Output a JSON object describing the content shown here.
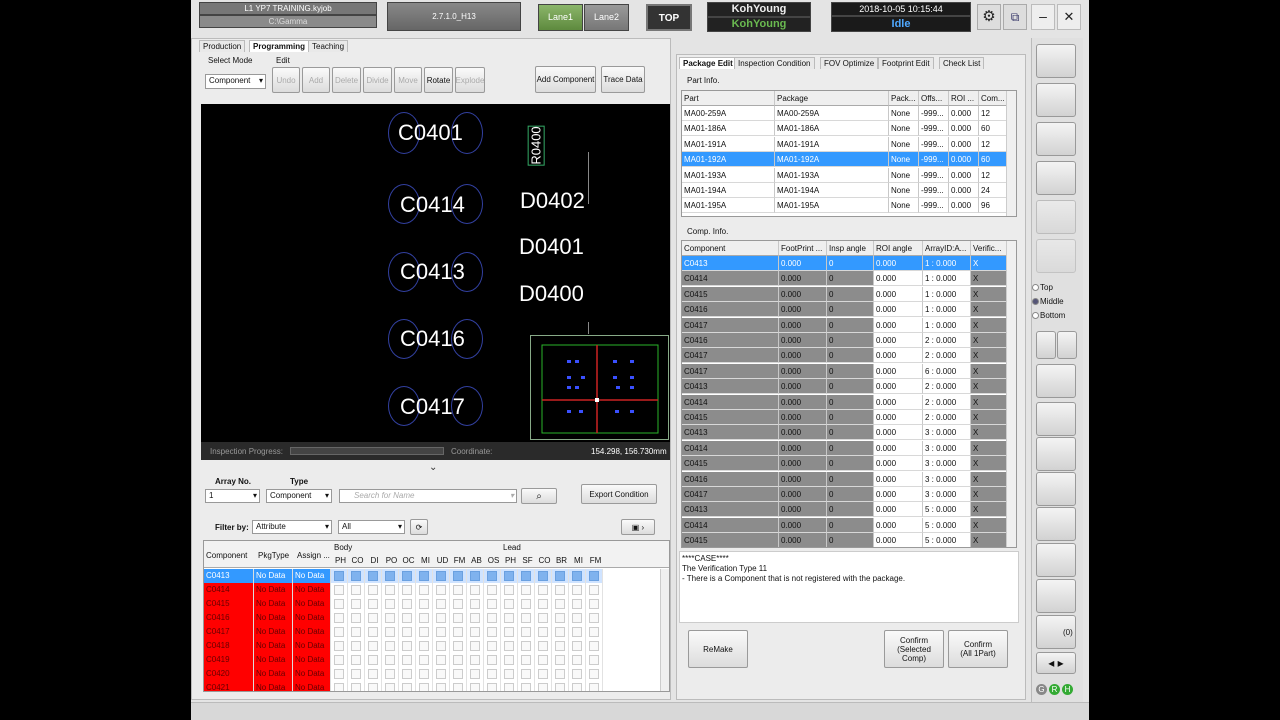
{
  "window": {
    "job_name": "L1 YP7 TRAINING.kyjob",
    "job_path": "C:\\Gamma",
    "version": "2.7.1.0_H13",
    "lane1": "Lane1",
    "lane2": "Lane2",
    "top_button": "TOP",
    "brand1": "KohYoung",
    "brand2": "KohYoung",
    "datetime": "2018-10-05 10:15:44",
    "status": "Idle"
  },
  "left_tabs": [
    "Production",
    "Programming",
    "Teaching"
  ],
  "select_mode": {
    "label": "Select Mode",
    "value": "Component"
  },
  "edit": {
    "label": "Edit",
    "buttons": [
      "Undo",
      "Add",
      "Delete",
      "Divide",
      "Move",
      "Rotate",
      "Explode"
    ]
  },
  "actions": {
    "add_component": "Add Component",
    "trace_data": "Trace Data"
  },
  "canvas": {
    "labels": [
      "C0401",
      "C0414",
      "C0413",
      "C0416",
      "C0417",
      "D0402",
      "D0401",
      "D0400",
      "R0400"
    ],
    "progress_label": "Inspection Progress:",
    "coord_label": "Coordinate:",
    "coord_value": "154.298, 156.730mm"
  },
  "lower": {
    "array_no_label": "Array No.",
    "array_no_value": "1",
    "type_label": "Type",
    "type_value": "Component",
    "search_placeholder": "Search for Name",
    "export_condition": "Export Condition",
    "filter_label": "Filter by:",
    "filter_value": "Attribute",
    "filter_value2": "All",
    "headers": {
      "component": "Component",
      "pkgtype": "PkgType",
      "assign": "Assign ...",
      "body": "Body",
      "lead": "Lead"
    },
    "body_cols": [
      "PH",
      "CO",
      "DI",
      "PO",
      "OC",
      "MI",
      "UD",
      "FM",
      "AB",
      "OS"
    ],
    "lead_cols": [
      "PH",
      "SF",
      "CO",
      "BR",
      "MI",
      "FM"
    ],
    "rows": [
      {
        "c": "C0413",
        "p": "No Data",
        "a": "No Data"
      },
      {
        "c": "C0414",
        "p": "No Data",
        "a": "No Data"
      },
      {
        "c": "C0415",
        "p": "No Data",
        "a": "No Data"
      },
      {
        "c": "C0416",
        "p": "No Data",
        "a": "No Data"
      },
      {
        "c": "C0417",
        "p": "No Data",
        "a": "No Data"
      },
      {
        "c": "C0418",
        "p": "No Data",
        "a": "No Data"
      },
      {
        "c": "C0419",
        "p": "No Data",
        "a": "No Data"
      },
      {
        "c": "C0420",
        "p": "No Data",
        "a": "No Data"
      },
      {
        "c": "C0421",
        "p": "No Data",
        "a": "No Data"
      }
    ]
  },
  "right_tabs": [
    "Package Edit",
    "Inspection Condition",
    "FOV Optimize",
    "Footprint Edit",
    "Check List"
  ],
  "part_info": {
    "title": "Part Info.",
    "headers": [
      "Part",
      "Package",
      "Pack...",
      "Offs...",
      "ROI ...",
      "Com..."
    ],
    "rows": [
      [
        "MA00-259A",
        "MA00-259A",
        "None",
        "-999...",
        "0.000",
        "12"
      ],
      [
        "MA01-186A",
        "MA01-186A",
        "None",
        "-999...",
        "0.000",
        "60"
      ],
      [
        "MA01-191A",
        "MA01-191A",
        "None",
        "-999...",
        "0.000",
        "12"
      ],
      [
        "MA01-192A",
        "MA01-192A",
        "None",
        "-999...",
        "0.000",
        "60"
      ],
      [
        "MA01-193A",
        "MA01-193A",
        "None",
        "-999...",
        "0.000",
        "12"
      ],
      [
        "MA01-194A",
        "MA01-194A",
        "None",
        "-999...",
        "0.000",
        "24"
      ],
      [
        "MA01-195A",
        "MA01-195A",
        "None",
        "-999...",
        "0.000",
        "96"
      ]
    ]
  },
  "comp_info": {
    "title": "Comp. Info.",
    "headers": [
      "Component",
      "FootPrint ...",
      "Insp angle",
      "ROI angle",
      "ArrayID:A...",
      "Verific..."
    ],
    "rows": [
      [
        "C0413",
        "0.000",
        "0",
        "0.000",
        "1 : 0.000",
        "X"
      ],
      [
        "C0414",
        "0.000",
        "0",
        "0.000",
        "1 : 0.000",
        "X"
      ],
      [
        "C0415",
        "0.000",
        "0",
        "0.000",
        "1 : 0.000",
        "X"
      ],
      [
        "C0416",
        "0.000",
        "0",
        "0.000",
        "1 : 0.000",
        "X"
      ],
      [
        "C0417",
        "0.000",
        "0",
        "0.000",
        "1 : 0.000",
        "X"
      ],
      [
        "C0416",
        "0.000",
        "0",
        "0.000",
        "2 : 0.000",
        "X"
      ],
      [
        "C0417",
        "0.000",
        "0",
        "0.000",
        "2 : 0.000",
        "X"
      ],
      [
        "C0417",
        "0.000",
        "0",
        "0.000",
        "6 : 0.000",
        "X"
      ],
      [
        "C0413",
        "0.000",
        "0",
        "0.000",
        "2 : 0.000",
        "X"
      ],
      [
        "C0414",
        "0.000",
        "0",
        "0.000",
        "2 : 0.000",
        "X"
      ],
      [
        "C0415",
        "0.000",
        "0",
        "0.000",
        "2 : 0.000",
        "X"
      ],
      [
        "C0413",
        "0.000",
        "0",
        "0.000",
        "3 : 0.000",
        "X"
      ],
      [
        "C0414",
        "0.000",
        "0",
        "0.000",
        "3 : 0.000",
        "X"
      ],
      [
        "C0415",
        "0.000",
        "0",
        "0.000",
        "3 : 0.000",
        "X"
      ],
      [
        "C0416",
        "0.000",
        "0",
        "0.000",
        "3 : 0.000",
        "X"
      ],
      [
        "C0417",
        "0.000",
        "0",
        "0.000",
        "3 : 0.000",
        "X"
      ],
      [
        "C0413",
        "0.000",
        "0",
        "0.000",
        "5 : 0.000",
        "X"
      ],
      [
        "C0414",
        "0.000",
        "0",
        "0.000",
        "5 : 0.000",
        "X"
      ],
      [
        "C0415",
        "0.000",
        "0",
        "0.000",
        "5 : 0.000",
        "X"
      ]
    ]
  },
  "message": {
    "line1": "****CASE****",
    "line2": "The Verification Type 11",
    "line3": " - There is a Component that is not registered with the package."
  },
  "bottom_buttons": {
    "remake": "ReMake",
    "confirm_sel": "Confirm\n(Selected Comp)",
    "confirm_all": "Confirm\n(All 1Part)"
  },
  "side": {
    "radio": [
      "Top",
      "Middle",
      "Bottom"
    ],
    "count": "(0)"
  },
  "colors": {
    "selection": "#3399ff",
    "error_row": "#ff0000",
    "dark_row": "#8c8c8c",
    "accent_green": "#6c9a4c"
  }
}
